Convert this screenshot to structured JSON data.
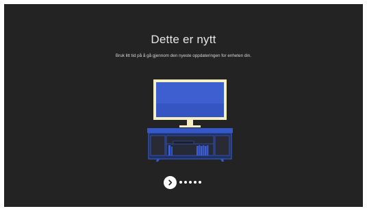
{
  "header": {
    "title": "Dette er nytt",
    "subtitle": "Bruk litt tid på å gå gjennom den nyeste oppdateringen for enheten din."
  },
  "illustration": {
    "icon": "tv-on-media-console-illustration",
    "screen_color": "#3d5fd0",
    "frame_color": "#f5efc2",
    "console_color": "#3557c9"
  },
  "pager": {
    "next_icon": "chevron-right-icon",
    "total_pages": 6,
    "current_page": 1
  },
  "colors": {
    "background": "#232323",
    "text": "#e6e6e6",
    "button": "#ffffff"
  }
}
